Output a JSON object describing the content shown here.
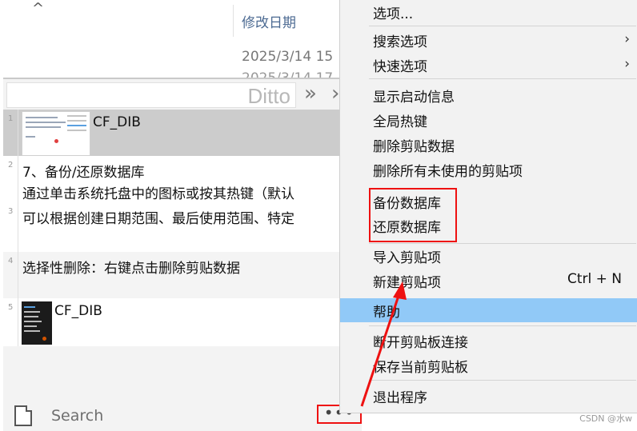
{
  "explorer": {
    "column_header": "修改日期",
    "date_1": "2025/3/14 15",
    "date_2": "2025/3/14 17"
  },
  "ditto": {
    "title": "Ditto",
    "clips": [
      {
        "index": "1",
        "text": "CF_DIB"
      },
      {
        "index": "2",
        "line1": "7、备份/还原数据库",
        "line2": "通过单击系统托盘中的图标或按其热键（默认"
      },
      {
        "index": "3",
        "text": "可以根据创建日期范围、最后使用范围、特定"
      },
      {
        "index": "4",
        "text": "选择性删除：右键点击删除剪贴数据"
      },
      {
        "index": "5",
        "text": "CF_DIB"
      }
    ],
    "search_label": "Search",
    "more_button": "•••"
  },
  "menu": {
    "items": [
      {
        "label": "选项..."
      },
      {
        "label": "搜索选项",
        "arrow": "›"
      },
      {
        "label": "快速选项",
        "arrow": "›"
      },
      {
        "label": "显示启动信息"
      },
      {
        "label": "全局热键"
      },
      {
        "label": "删除剪贴数据"
      },
      {
        "label": "删除所有未使用的剪贴项"
      },
      {
        "label": "备份数据库"
      },
      {
        "label": "还原数据库"
      },
      {
        "label": "导入剪贴项"
      },
      {
        "label": "新建剪贴项",
        "shortcut": "Ctrl + N"
      },
      {
        "label": "帮助"
      },
      {
        "label": "断开剪贴板连接"
      },
      {
        "label": "保存当前剪贴板"
      },
      {
        "label": "退出程序"
      }
    ]
  },
  "watermark": "CSDN @水w",
  "colors": {
    "highlight": "#91c9f7",
    "annotation_red": "#e11111"
  },
  "icons": {
    "explorer_up": "up-chevron-icon",
    "ditto_expand": "double-chevron-right-icon",
    "ditto_doc": "document-icon",
    "menu_submenu": "chevron-right-icon"
  }
}
